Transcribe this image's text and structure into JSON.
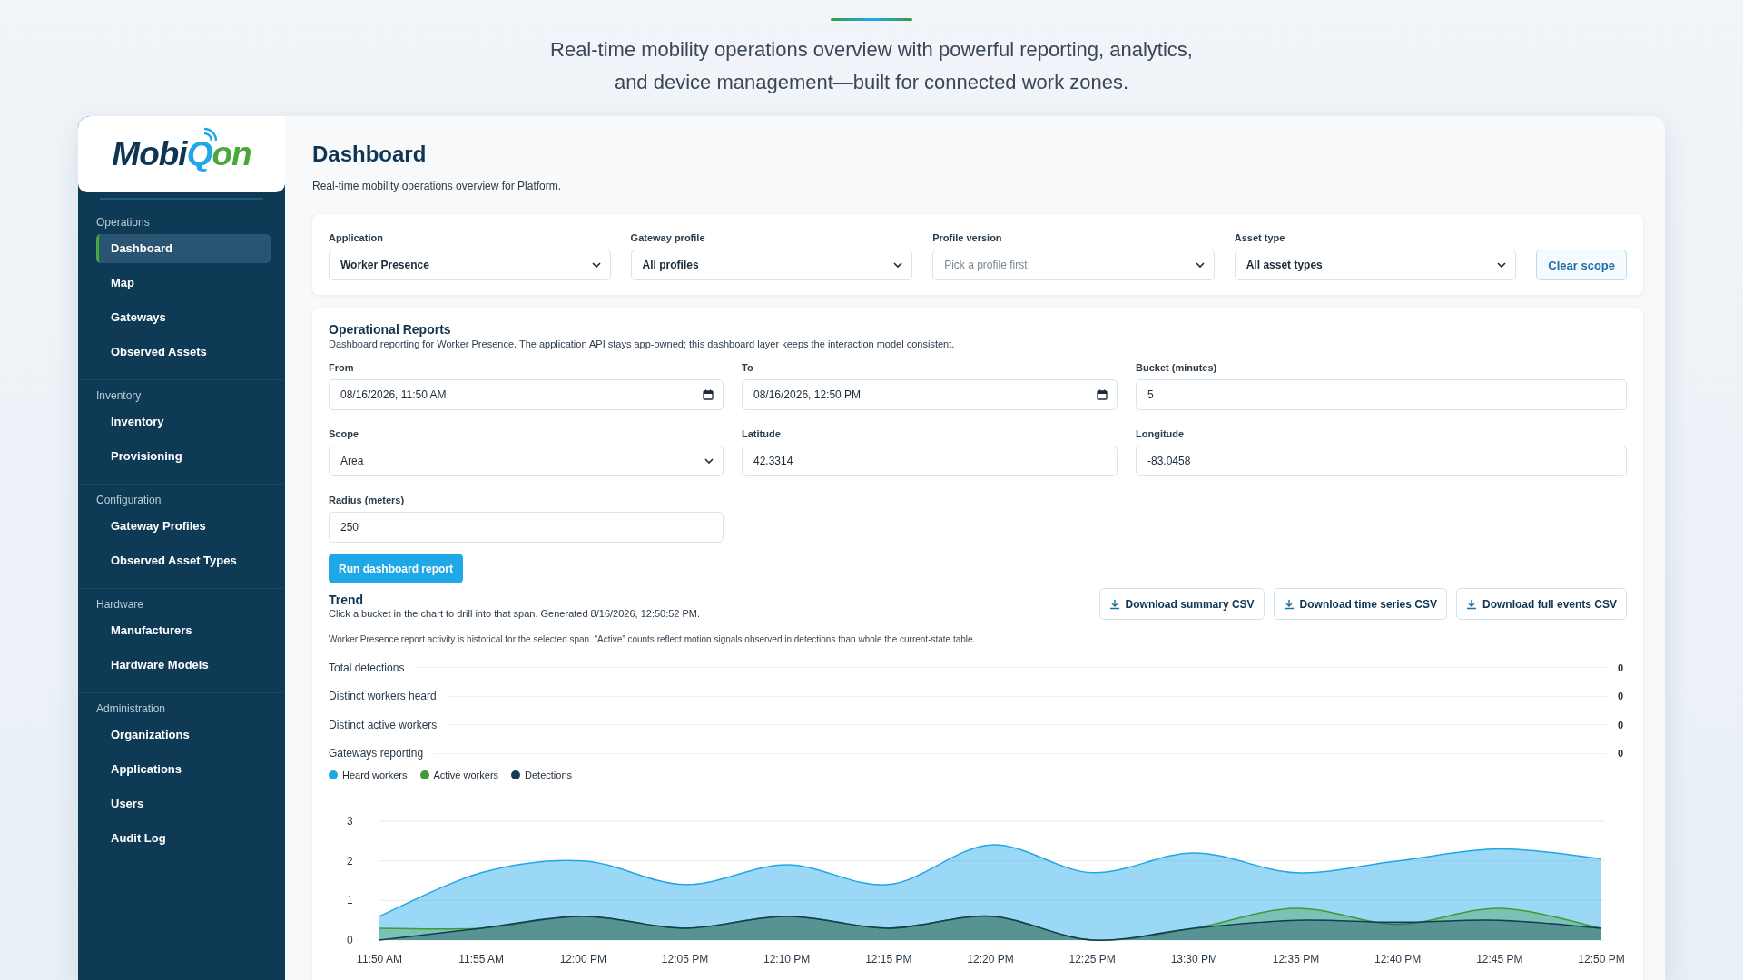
{
  "intro": {
    "subtitle_lines": [
      "Real-time mobility operations overview with powerful reporting, analytics,",
      "and device management—built for connected work zones."
    ]
  },
  "logo": {
    "text": "Mobi",
    "mark": "Q",
    "suffix": "on"
  },
  "sidebar": {
    "sections": [
      {
        "title": "Operations",
        "items": [
          {
            "label": "Dashboard",
            "selected": true
          },
          {
            "label": "Map",
            "selected": false
          },
          {
            "label": "Gateways",
            "selected": false
          },
          {
            "label": "Observed Assets",
            "selected": false
          }
        ]
      },
      {
        "title": "Inventory",
        "items": [
          {
            "label": "Inventory",
            "selected": false
          },
          {
            "label": "Provisioning",
            "selected": false
          }
        ]
      },
      {
        "title": "Configuration",
        "items": [
          {
            "label": "Gateway Profiles",
            "selected": false
          },
          {
            "label": "Observed Asset Types",
            "selected": false
          }
        ]
      },
      {
        "title": "Hardware",
        "items": [
          {
            "label": "Manufacturers",
            "selected": false
          },
          {
            "label": "Hardware Models",
            "selected": false
          }
        ]
      },
      {
        "title": "Administration",
        "items": [
          {
            "label": "Organizations",
            "selected": false
          },
          {
            "label": "Applications",
            "selected": false
          },
          {
            "label": "Users",
            "selected": false
          },
          {
            "label": "Audit Log",
            "selected": false
          }
        ]
      }
    ]
  },
  "header": {
    "title": "Dashboard",
    "subtitle": "Real-time mobility operations overview for Platform."
  },
  "scope_filters": [
    {
      "label": "Application",
      "value": "Worker Presence"
    },
    {
      "label": "Gateway profile",
      "value": "All profiles"
    },
    {
      "label": "Profile version",
      "placeholder": "Pick a profile first"
    },
    {
      "label": "Asset type",
      "value": "All asset types"
    }
  ],
  "clear_button": "Clear scope",
  "reports": {
    "title": "Operational Reports",
    "description": "Dashboard reporting for Worker Presence. The application API stays app-owned; this dashboard layer keeps the interaction model consistent.",
    "fields": [
      {
        "label": "From",
        "value": "08/16/2026, 11:50 AM",
        "kind": "datetime"
      },
      {
        "label": "To",
        "value": "08/16/2026, 12:50 PM",
        "kind": "datetime"
      },
      {
        "label": "Bucket (minutes)",
        "value": "5",
        "kind": "text"
      },
      {
        "label": "Scope",
        "value": "Area",
        "kind": "select"
      },
      {
        "label": "Latitude",
        "value": "42.3314",
        "kind": "text"
      },
      {
        "label": "Longitude",
        "value": "-83.0458",
        "kind": "text"
      },
      {
        "label": "Radius (meters)",
        "value": "250",
        "kind": "text"
      }
    ],
    "run_button": "Run dashboard report"
  },
  "trend": {
    "title": "Trend",
    "subtitle": "Click a bucket in the chart to drill into that span. Generated 8/16/2026, 12:50:52 PM.",
    "downloads": [
      "Download summary CSV",
      "Download time series CSV",
      "Download full events CSV"
    ],
    "note": "Worker Presence report activity is historical for the selected span. “Active” counts reflect motion signals observed in detections than whole the current-state table.",
    "stats": [
      {
        "label": "Total detections",
        "value": "0"
      },
      {
        "label": "Distinct workers heard",
        "value": "0"
      },
      {
        "label": "Distinct active workers",
        "value": "0"
      },
      {
        "label": "Gateways reporting",
        "value": "0"
      }
    ],
    "chart_data": {
      "type": "area",
      "categories": [
        "11:50 AM",
        "11:55 AM",
        "12:00 PM",
        "12:05 PM",
        "12:10 PM",
        "12:15 PM",
        "12:20 PM",
        "12:25 PM",
        "13:30 PM",
        "12:35 PM",
        "12:40 PM",
        "12:45 PM",
        "12:50 PM"
      ],
      "ylim": [
        0,
        3
      ],
      "yticks": [
        0,
        1,
        2,
        3
      ],
      "series": [
        {
          "name": "Heard workers",
          "color": "#1fa8e8",
          "values": [
            0.6,
            1.7,
            2.0,
            1.4,
            1.9,
            1.4,
            2.4,
            1.7,
            2.2,
            1.7,
            2.0,
            2.3,
            2.05
          ]
        },
        {
          "name": "Active workers",
          "color": "#3f9a3a",
          "values": [
            0.3,
            0.3,
            0.6,
            0.3,
            0.6,
            0.3,
            0.6,
            0.0,
            0.3,
            0.8,
            0.4,
            0.8,
            0.3
          ]
        },
        {
          "name": "Detections",
          "color": "#163b57",
          "values": [
            0.0,
            0.3,
            0.6,
            0.3,
            0.6,
            0.3,
            0.6,
            0.0,
            0.3,
            0.5,
            0.45,
            0.5,
            0.3
          ]
        }
      ]
    }
  }
}
